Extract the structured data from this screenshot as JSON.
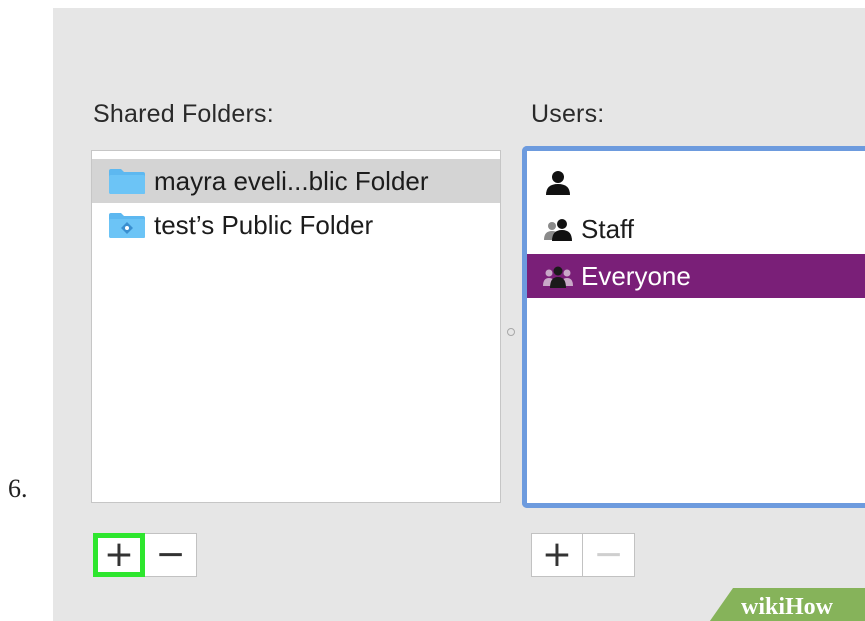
{
  "step_number": "6.",
  "shared_folders": {
    "label": "Shared Folders:",
    "items": [
      {
        "name": "mayra eveli...blic Folder",
        "selected": true,
        "icon": "folder-icon"
      },
      {
        "name": "test’s Public Folder",
        "selected": false,
        "icon": "public-folder-icon"
      }
    ],
    "add_label": "+",
    "remove_label": "−"
  },
  "users": {
    "label": "Users:",
    "items": [
      {
        "name": "",
        "icon": "single-user-icon",
        "selected": false
      },
      {
        "name": "Staff",
        "icon": "group-icon",
        "selected": false
      },
      {
        "name": "Everyone",
        "icon": "everyone-icon",
        "selected": true
      }
    ],
    "add_label": "+",
    "remove_label": "−"
  },
  "watermark": {
    "wiki": "wiki",
    "how": "How"
  },
  "colors": {
    "panel_bg": "#e6e6e6",
    "selection_purple": "#7a1f78",
    "focus_ring": "#6d9bde",
    "highlight_green": "#2ee62e",
    "folder_blue": "#5db8f0"
  }
}
